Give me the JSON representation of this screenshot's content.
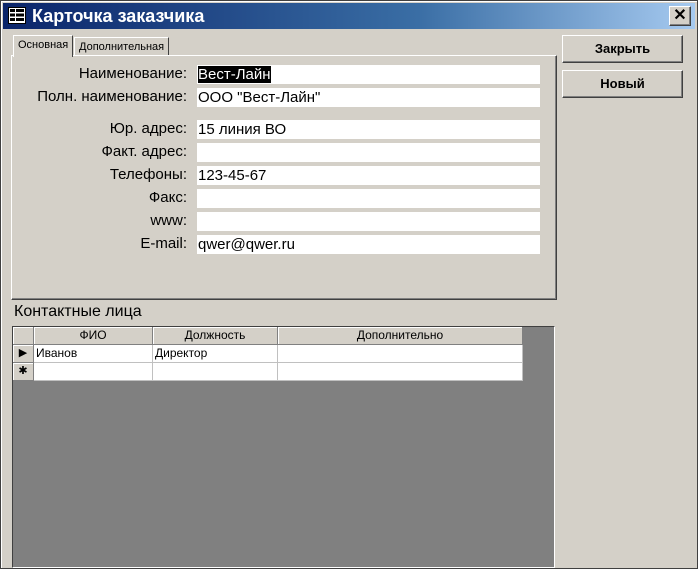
{
  "window": {
    "title": "Карточка заказчика",
    "close_glyph": "✕"
  },
  "tabs": [
    {
      "label": "Основная",
      "active": true
    },
    {
      "label": "Дополнительная",
      "active": false
    }
  ],
  "fields": {
    "name": {
      "label": "Наименование:",
      "value": "Вест-Лайн"
    },
    "full_name": {
      "label": "Полн. наименование:",
      "value": "ООО \"Вест-Лайн\""
    },
    "legal_address": {
      "label": "Юр. адрес:",
      "value": "15 линия ВО"
    },
    "actual_address": {
      "label": "Факт. адрес:",
      "value": ""
    },
    "phones": {
      "label": "Телефоны:",
      "value": "123-45-67"
    },
    "fax": {
      "label": "Факс:",
      "value": ""
    },
    "www": {
      "label": "www:",
      "value": ""
    },
    "email": {
      "label": "E-mail:",
      "value": "qwer@qwer.ru"
    }
  },
  "buttons": {
    "close": "Закрыть",
    "new": "Новый"
  },
  "contacts": {
    "title": "Контактные лица",
    "columns": [
      "ФИО",
      "Должность",
      "Дополнительно"
    ],
    "rows": [
      {
        "selector": "▶",
        "fio": "Иванов",
        "position": "Директор",
        "extra": ""
      },
      {
        "selector": "✱",
        "fio": "",
        "position": "",
        "extra": ""
      }
    ]
  },
  "colors": {
    "titlebar_start": "#0a246a",
    "titlebar_end": "#a6caf0",
    "face": "#d4d0c8",
    "grid_background": "#808080"
  }
}
